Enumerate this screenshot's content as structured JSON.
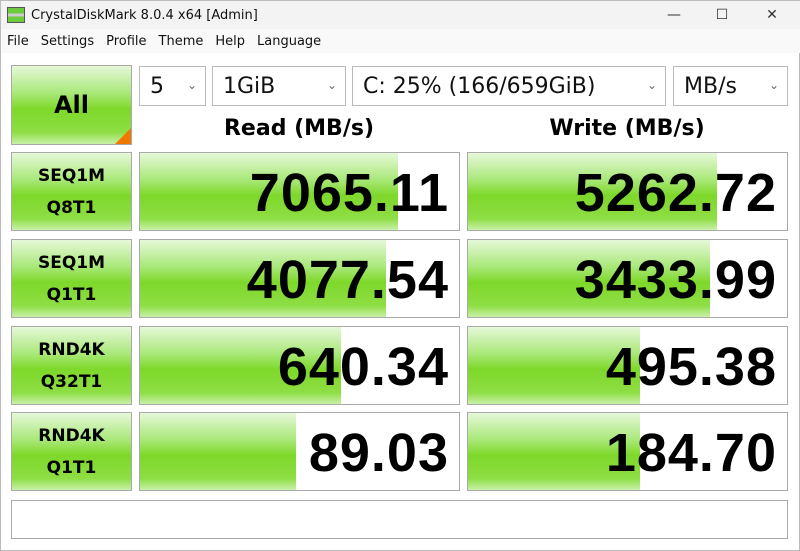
{
  "window": {
    "title": "CrystalDiskMark 8.0.4 x64 [Admin]",
    "minimize": "—",
    "maximize": "☐",
    "close": "✕"
  },
  "menu": [
    "File",
    "Settings",
    "Profile",
    "Theme",
    "Help",
    "Language"
  ],
  "controls": {
    "all_label": "All",
    "count": "5",
    "size": "1GiB",
    "drive": "C: 25% (166/659GiB)",
    "unit": "MB/s"
  },
  "headers": {
    "read": "Read (MB/s)",
    "write": "Write (MB/s)"
  },
  "rows": [
    {
      "l1": "SEQ1M",
      "l2": "Q8T1",
      "read": "7065.11",
      "write": "5262.72",
      "read_fill": 0.81,
      "write_fill": 0.78
    },
    {
      "l1": "SEQ1M",
      "l2": "Q1T1",
      "read": "4077.54",
      "write": "3433.99",
      "read_fill": 0.77,
      "write_fill": 0.76
    },
    {
      "l1": "RND4K",
      "l2": "Q32T1",
      "read": "640.34",
      "write": "495.38",
      "read_fill": 0.63,
      "write_fill": 0.54
    },
    {
      "l1": "RND4K",
      "l2": "Q1T1",
      "read": "89.03",
      "write": "184.70",
      "read_fill": 0.49,
      "write_fill": 0.54
    }
  ],
  "status": ""
}
